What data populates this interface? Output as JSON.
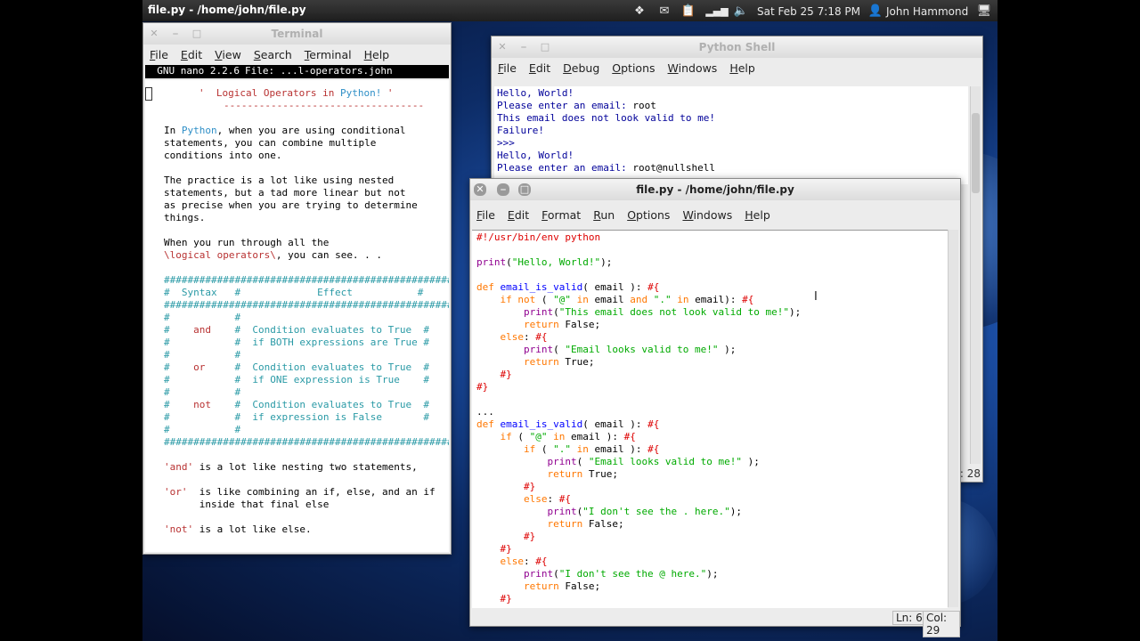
{
  "panel": {
    "window_title": "file.py - /home/john/file.py",
    "clock": "Sat Feb 25  7:18 PM",
    "user": "John Hammond"
  },
  "terminal": {
    "title": "Terminal",
    "menu": [
      "File",
      "Edit",
      "View",
      "Search",
      "Terminal",
      "Help"
    ],
    "nano_version": "  GNU nano 2.2.6",
    "nano_file": "File: ...l-operators.john",
    "content": {
      "heading_pre": "'  ",
      "heading_title": "Logical Operators in ",
      "heading_python": "Python!",
      "heading_post": " '",
      "heading_rule": "----------------------------------",
      "p1_l1_pre": "In ",
      "p1_l1_python": "Python",
      "p1_l1_post": ", when you are using conditional",
      "p1_l2": "statements, you can combine multiple",
      "p1_l3": "conditions into one.",
      "p2_l1": "The practice is a lot like using nested",
      "p2_l2": "statements, but a tad more linear but not",
      "p2_l3": "as precise when you are trying to determine",
      "p2_l4": "things.",
      "p3_l1": "When you run through all the",
      "p3_l2_kw": "\\logical operators\\",
      "p3_l2_post": ", you can see. . .",
      "hash_rule": "##################################################",
      "hdr_l": "#  Syntax   #",
      "hdr_m": "             Effect",
      "hdr_r": "           #",
      "blank_row": "#           #                                    #",
      "and_kw": "and",
      "and_e1": "Condition evaluates to True",
      "and_e2": "if BOTH expressions are True",
      "or_kw": "or",
      "or_e1": "Condition evaluates to True",
      "or_e2": "if ONE expression is True",
      "not_kw": "not",
      "not_e1": "Condition evaluates to True",
      "not_e2": "if expression is False",
      "and_note_kw": "'and'",
      "and_note": " is a lot like nesting two statements,",
      "or_note_kw": "'or'",
      "or_note": "  is like combining an if, else, and an if",
      "or_note2": "      inside that final else",
      "not_note_kw": "'not'",
      "not_note": " is a lot like else."
    }
  },
  "shell": {
    "title": "Python Shell",
    "menu": [
      "File",
      "Edit",
      "Debug",
      "Options",
      "Windows",
      "Help"
    ],
    "lines": [
      {
        "text": "Hello, World!",
        "cls": "s-blue"
      },
      {
        "prompt": "Please enter an email: ",
        "value": "root"
      },
      {
        "text": "This email does not look valid to me!",
        "cls": "s-blue"
      },
      {
        "text": "Failure!",
        "cls": "s-blue"
      },
      {
        "text": ">>> ",
        "cls": "s-blue"
      },
      {
        "text": "Hello, World!",
        "cls": "s-blue"
      },
      {
        "prompt": "Please enter an email: ",
        "value": "root@nullshell"
      }
    ],
    "status_col": ": 28"
  },
  "editor": {
    "title": "file.py - /home/john/file.py",
    "menu": [
      "File",
      "Edit",
      "Format",
      "Run",
      "Options",
      "Windows",
      "Help"
    ],
    "status_ln": "Ln: 6",
    "status_col": "Col: 29",
    "code": [
      [
        [
          "c",
          "#!/usr/bin/env python"
        ]
      ],
      [],
      [
        [
          "b",
          "print"
        ],
        [
          "",
          "("
        ],
        [
          "s",
          "\"Hello, World!\""
        ],
        [
          "",
          ");"
        ]
      ],
      [],
      [
        [
          "k",
          "def "
        ],
        [
          "d",
          "email_is_valid"
        ],
        [
          "",
          "( email ): "
        ],
        [
          "c",
          "#{"
        ]
      ],
      [
        [
          "k",
          "    if not "
        ],
        [
          "",
          "( "
        ],
        [
          "s",
          "\"@\""
        ],
        [
          "k",
          " in "
        ],
        [
          "",
          "email "
        ],
        [
          "k",
          "and "
        ],
        [
          "s",
          "\".\""
        ],
        [
          "k",
          " in "
        ],
        [
          "",
          "email): "
        ],
        [
          "c",
          "#{"
        ]
      ],
      [
        [
          "b",
          "        print"
        ],
        [
          "",
          "("
        ],
        [
          "s",
          "\"This email does not look valid to me!\""
        ],
        [
          "",
          ");"
        ]
      ],
      [
        [
          "k",
          "        return "
        ],
        [
          "",
          "False;"
        ]
      ],
      [
        [
          "k",
          "    else"
        ],
        [
          "",
          ": "
        ],
        [
          "c",
          "#{"
        ]
      ],
      [
        [
          "b",
          "        print"
        ],
        [
          "",
          "( "
        ],
        [
          "s",
          "\"Email looks valid to me!\""
        ],
        [
          "",
          " );"
        ]
      ],
      [
        [
          "k",
          "        return "
        ],
        [
          "",
          "True;"
        ]
      ],
      [
        [
          "c",
          "    #}"
        ]
      ],
      [
        [
          "c",
          "#}"
        ]
      ],
      [],
      [
        [
          "",
          "..."
        ]
      ],
      [
        [
          "k",
          "def "
        ],
        [
          "d",
          "email_is_valid"
        ],
        [
          "",
          "( email ): "
        ],
        [
          "c",
          "#{"
        ]
      ],
      [
        [
          "k",
          "    if "
        ],
        [
          "",
          "( "
        ],
        [
          "s",
          "\"@\""
        ],
        [
          "k",
          " in "
        ],
        [
          "",
          "email ): "
        ],
        [
          "c",
          "#{"
        ]
      ],
      [
        [
          "k",
          "        if "
        ],
        [
          "",
          "( "
        ],
        [
          "s",
          "\".\""
        ],
        [
          "k",
          " in "
        ],
        [
          "",
          "email ): "
        ],
        [
          "c",
          "#{"
        ]
      ],
      [
        [
          "b",
          "            print"
        ],
        [
          "",
          "( "
        ],
        [
          "s",
          "\"Email looks valid to me!\""
        ],
        [
          "",
          " );"
        ]
      ],
      [
        [
          "k",
          "            return "
        ],
        [
          "",
          "True;"
        ]
      ],
      [
        [
          "c",
          "        #}"
        ]
      ],
      [
        [
          "k",
          "        else"
        ],
        [
          "",
          ": "
        ],
        [
          "c",
          "#{"
        ]
      ],
      [
        [
          "b",
          "            print"
        ],
        [
          "",
          "("
        ],
        [
          "s",
          "\"I don't see the . here.\""
        ],
        [
          "",
          ");"
        ]
      ],
      [
        [
          "k",
          "            return "
        ],
        [
          "",
          "False;"
        ]
      ],
      [
        [
          "c",
          "        #}"
        ]
      ],
      [
        [
          "c",
          "    #}"
        ]
      ],
      [
        [
          "k",
          "    else"
        ],
        [
          "",
          ": "
        ],
        [
          "c",
          "#{"
        ]
      ],
      [
        [
          "b",
          "        print"
        ],
        [
          "",
          "("
        ],
        [
          "s",
          "\"I don't see the @ here.\""
        ],
        [
          "",
          ");"
        ]
      ],
      [
        [
          "k",
          "        return "
        ],
        [
          "",
          "False;"
        ]
      ],
      [
        [
          "c",
          "    #}"
        ]
      ]
    ]
  },
  "icons": [
    "dropbox-icon",
    "mail-icon",
    "clipboard-icon",
    "signal-icon",
    "volume-icon",
    "user-icon",
    "monitor-icon",
    "text-cursor-icon"
  ]
}
